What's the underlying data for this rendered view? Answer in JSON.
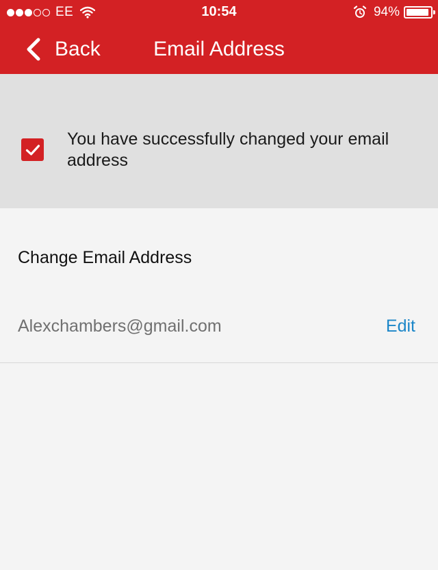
{
  "status_bar": {
    "carrier": "EE",
    "time": "10:54",
    "battery_percent": "94%",
    "battery_level": 0.94,
    "signal_bars_filled": 3,
    "signal_bars_total": 5
  },
  "nav": {
    "back_label": "Back",
    "title": "Email Address"
  },
  "banner": {
    "message": "You have successfully changed your email address",
    "checked": true
  },
  "section": {
    "heading": "Change Email Address"
  },
  "email_row": {
    "value": "Alexchambers@gmail.com",
    "edit_label": "Edit"
  },
  "colors": {
    "brand_red": "#d32124",
    "link_blue": "#1b86c8",
    "banner_bg": "#e0e0e0",
    "page_bg": "#f4f4f4"
  },
  "icons": {
    "back": "chevron-left-icon",
    "check": "checkmark-icon",
    "wifi": "wifi-icon",
    "alarm": "alarm-icon",
    "battery": "battery-icon"
  }
}
